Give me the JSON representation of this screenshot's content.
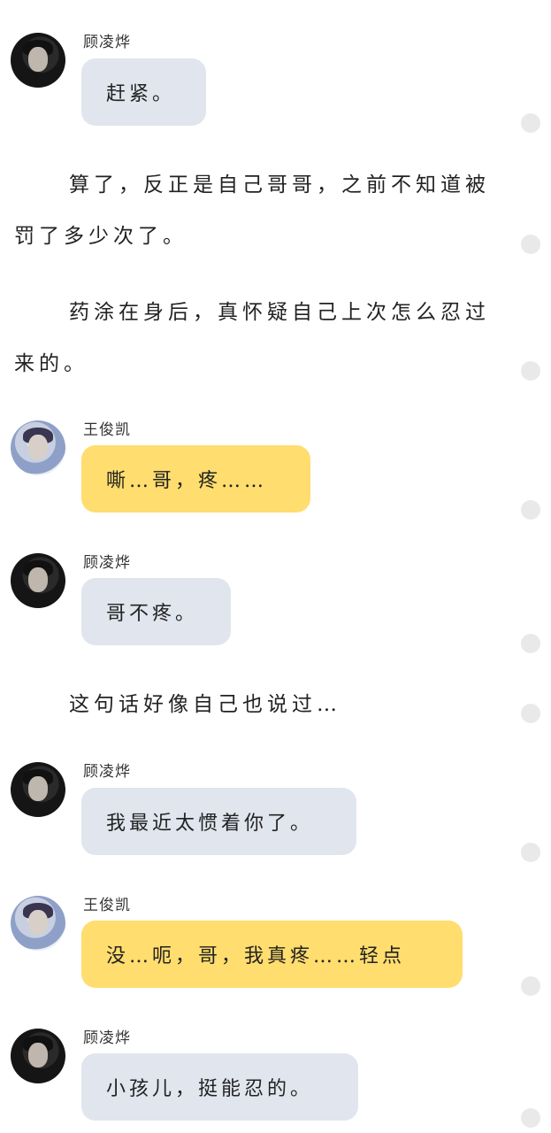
{
  "messages": [
    {
      "speaker": "顾凌烨",
      "text": "赶紧。"
    },
    {
      "speaker": "王俊凯",
      "text": "嘶…哥，疼……"
    },
    {
      "speaker": "顾凌烨",
      "text": "哥不疼。"
    },
    {
      "speaker": "顾凌烨",
      "text": "我最近太惯着你了。"
    },
    {
      "speaker": "王俊凯",
      "text": "没…呃，哥，我真疼……轻点"
    },
    {
      "speaker": "顾凌烨",
      "text": "小孩儿，挺能忍的。"
    }
  ],
  "narration": [
    "算了，反正是自己哥哥，之前不知道被罚了多少次了。",
    "药涂在身后，真怀疑自己上次怎么忍过来的。",
    "这句话好像自己也说过…"
  ],
  "colors": {
    "bubble_gray": "#e0e5ee",
    "bubble_yellow": "#ffdd6e",
    "side_dot": "#e9e9e9"
  }
}
